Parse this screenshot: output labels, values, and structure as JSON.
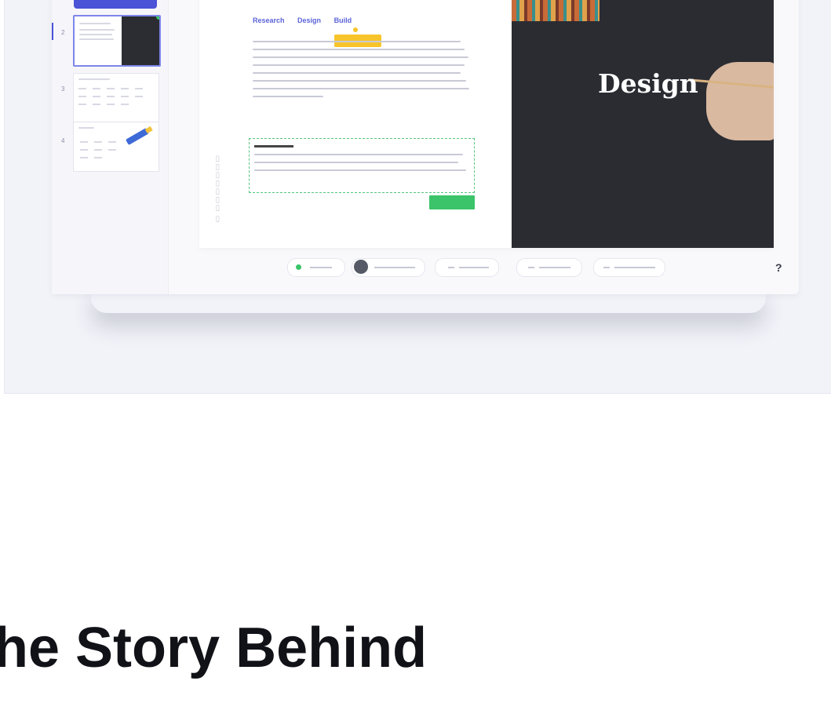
{
  "slide": {
    "tabs": [
      "Research",
      "Design",
      "Build"
    ],
    "photo_caption": "Design"
  },
  "sidebar": {
    "slide_numbers": [
      "2",
      "3",
      "4"
    ]
  },
  "bottom_bar": {
    "help_label": "?"
  },
  "section_heading": "he Story Behind",
  "colors": {
    "accent_blue": "#4b53d6",
    "status_green": "#3bc46a",
    "highlight_yellow": "#f7c52b",
    "photo_background": "#2a2c32"
  }
}
